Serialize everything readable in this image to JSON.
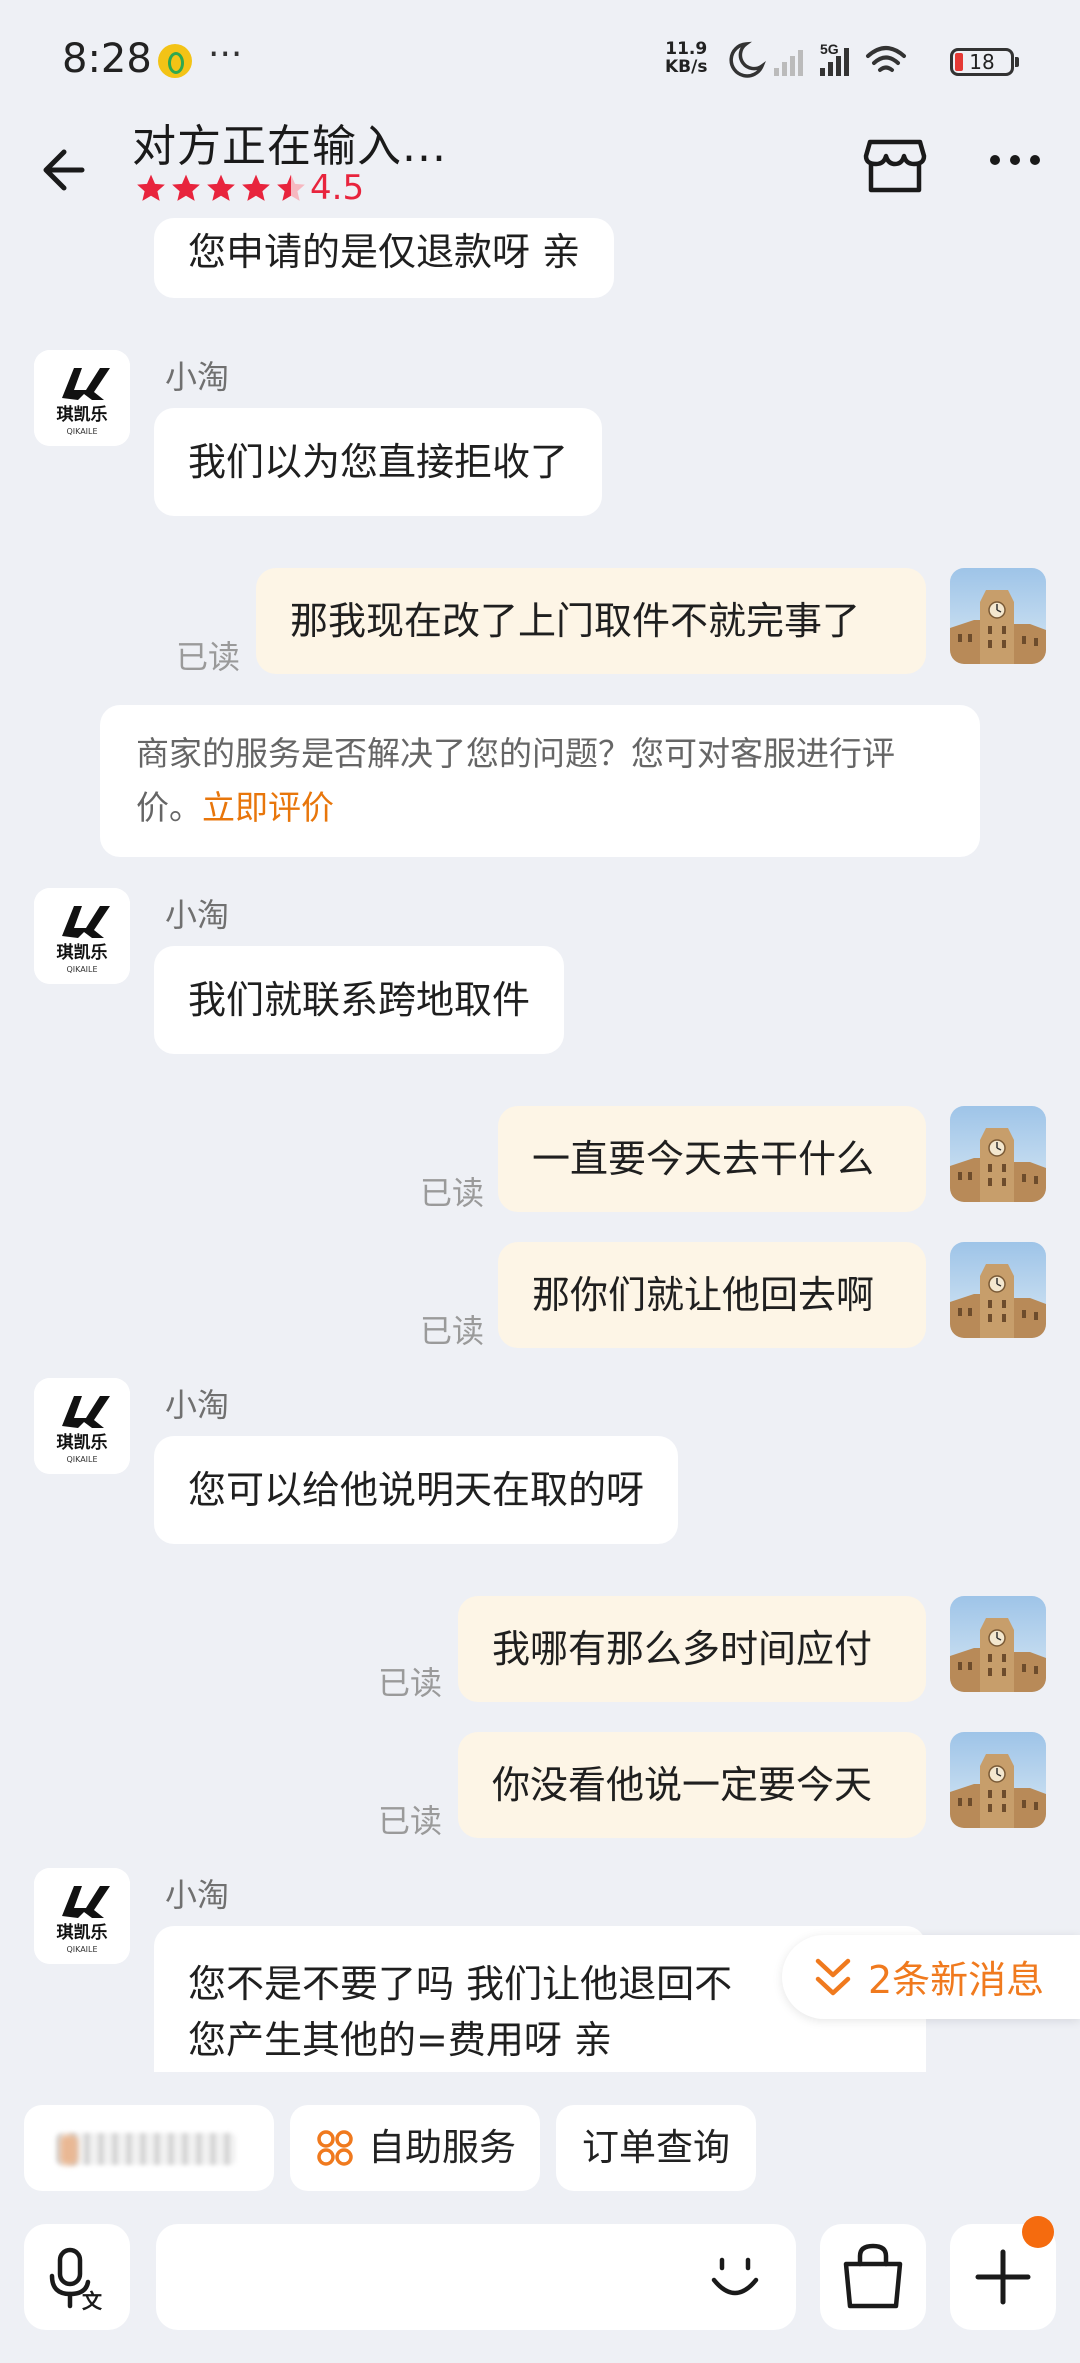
{
  "status_bar": {
    "time": "8:28",
    "dots": "···",
    "net_speed_value": "11.9",
    "net_speed_unit": "KB/s",
    "network": "5G",
    "battery": "18"
  },
  "header": {
    "title": "对方正在输入...",
    "rating": "4.5",
    "star_color": "#e8243d"
  },
  "messages": {
    "m0": "您申请的是仅退款呀 亲",
    "s1": "小淘",
    "m1": "我们以为您直接拒收了",
    "m2": "那我现在改了上门取件不就完事了",
    "r2": "已读",
    "sys_text": "商家的服务是否解决了您的问题？您可对客服进行评价。",
    "sys_link": "立即评价",
    "s3": "小淘",
    "m3": "我们就联系跨地取件",
    "m4": "一直要今天去干什么",
    "r4": "已读",
    "m5": "那你们就让他回去啊",
    "r5": "已读",
    "s6": "小淘",
    "m6": "您可以给他说明天在取的呀",
    "m7": "我哪有那么多时间应付",
    "r7": "已读",
    "m8": "你没看他说一定要今天",
    "r8": "已读",
    "s9": "小淘",
    "m9_line1": "您不是不要了吗  我们让他退回不",
    "m9_line2": "您产生其他的=费用呀 亲"
  },
  "new_messages": "2条新消息",
  "quick_actions": {
    "service": "自助服务",
    "order": "订单查询"
  },
  "shop_logo_text": "琪凯乐",
  "shop_logo_sub": "QIKAILE",
  "colors": {
    "accent_orange": "#f07a1e",
    "my_bubble": "#fdf5e6",
    "background": "#eef0f5"
  }
}
